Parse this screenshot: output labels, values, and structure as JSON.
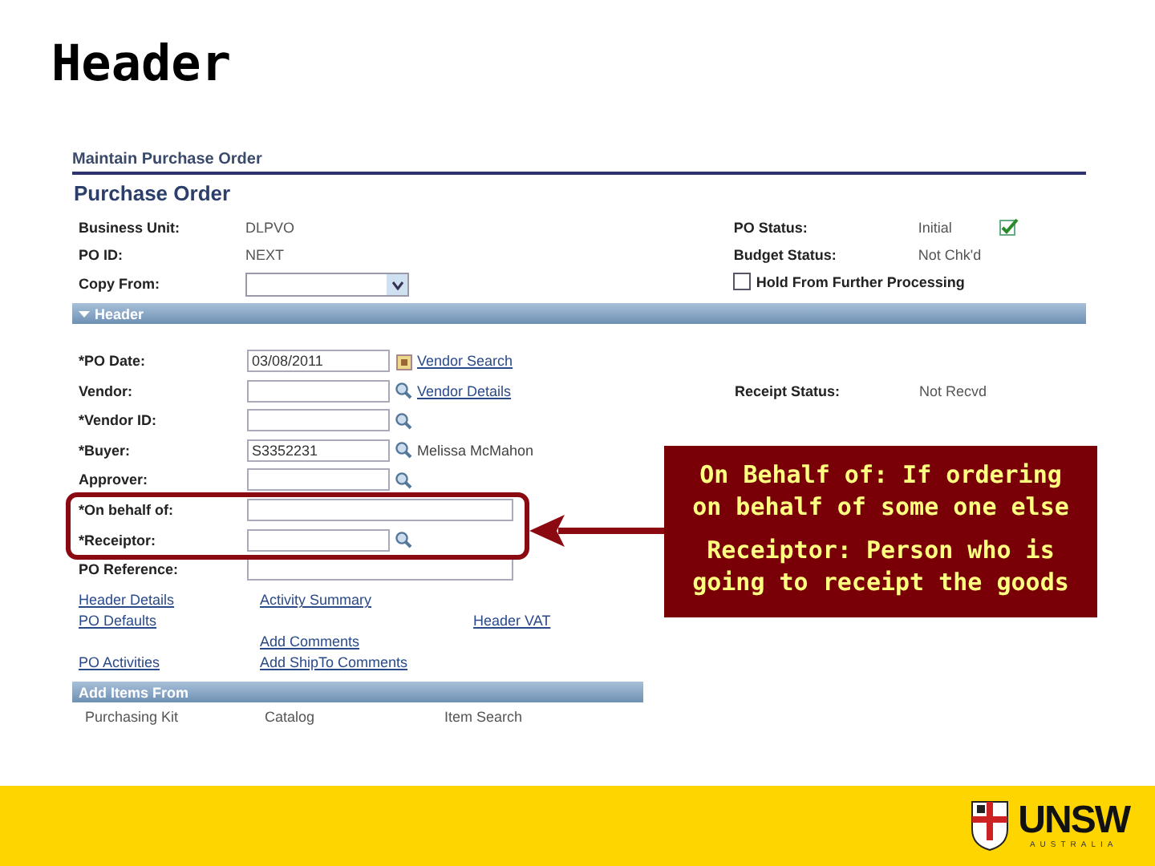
{
  "slide": {
    "title": "Header"
  },
  "page": {
    "breadcrumb": "Maintain Purchase Order",
    "title": "Purchase Order",
    "summary_left": [
      {
        "label": "Business Unit:",
        "value": "DLPVO",
        "kind": "text"
      },
      {
        "label": "PO ID:",
        "value": "NEXT",
        "kind": "text"
      },
      {
        "label": "Copy From:",
        "kind": "dropdown"
      }
    ],
    "summary_right": [
      {
        "label": "PO Status:",
        "value": "Initial"
      },
      {
        "label": "Budget Status:",
        "value": "Not Chk'd"
      }
    ],
    "hold": {
      "label": "Hold From Further Processing",
      "checked": false
    },
    "header_section": {
      "label": "Header",
      "expanded": true
    },
    "fields": [
      {
        "label": "*PO Date:",
        "value": "03/08/2011",
        "kind": "date",
        "link": "Vendor Search"
      },
      {
        "label": "Vendor:",
        "kind": "lookup",
        "link": "Vendor Details"
      },
      {
        "label": "*Vendor ID:",
        "kind": "lookup"
      },
      {
        "label": "*Buyer:",
        "value": "S3352231",
        "kind": "lookup",
        "note": "Melissa McMahon"
      },
      {
        "label": "Approver:",
        "kind": "lookup"
      },
      {
        "label": "*On behalf of:",
        "kind": "wide"
      },
      {
        "label": "*Receiptor:",
        "kind": "lookup"
      },
      {
        "label": "PO Reference:",
        "kind": "wide"
      }
    ],
    "receipt_status": {
      "label": "Receipt Status:",
      "value": "Not Recvd"
    },
    "link_rows": [
      {
        "col_1": "Header Details",
        "col_2": "Activity Summary"
      },
      {
        "col_1": "PO Defaults",
        "col_3": "Header VAT"
      },
      {
        "col_2": "Add Comments"
      },
      {
        "col_1": "PO Activities",
        "col_2": "Add ShipTo Comments"
      }
    ],
    "add_items": {
      "title": "Add Items From",
      "items": [
        "Purchasing Kit",
        "Catalog",
        "Item Search"
      ]
    }
  },
  "callout": {
    "paragraphs": [
      "On Behalf of: If ordering on behalf of some one else",
      "Receiptor: Person who is going to receipt the goods"
    ]
  },
  "footer": {
    "logo_text": "UNSW",
    "logo_subtext": "AUSTRALIA"
  }
}
